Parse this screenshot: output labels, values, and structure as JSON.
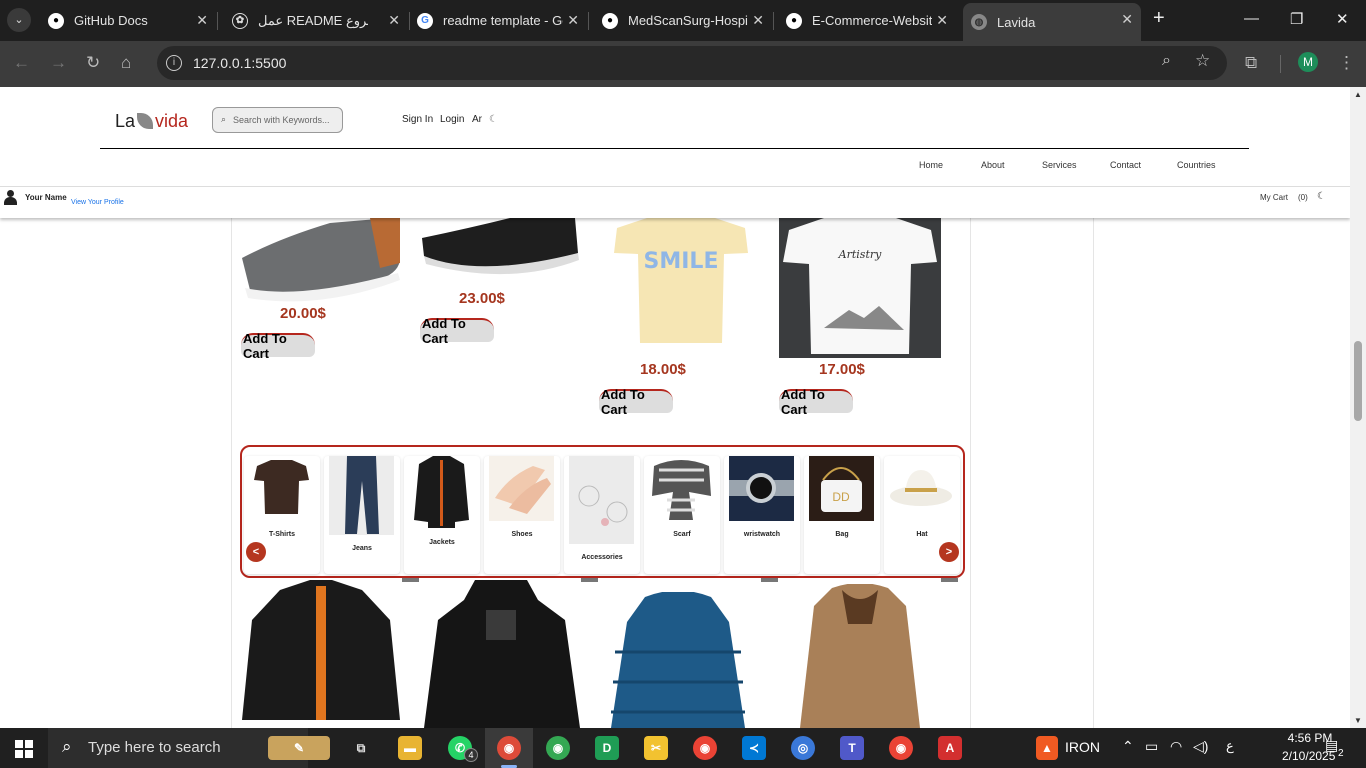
{
  "browser": {
    "tabs": [
      {
        "title": "GitHub Docs"
      },
      {
        "title": "عمل README لمشروع"
      },
      {
        "title": "readme template - Go"
      },
      {
        "title": "MedScanSurg-Hospit"
      },
      {
        "title": "E-Commerce-Website"
      },
      {
        "title": "Lavida"
      }
    ],
    "new_tab": "+",
    "url": "127.0.0.1:5500",
    "profile_initial": "M"
  },
  "site": {
    "logo": {
      "part1": "La",
      "part2": "vida"
    },
    "search_placeholder": "Search with Keywords...",
    "header_links": {
      "sign_in": "Sign In",
      "login": "Login",
      "lang": "Ar",
      "theme": "☾"
    },
    "nav": [
      "Home",
      "About",
      "Services",
      "Contact",
      "Countries"
    ],
    "user": {
      "name": "Your Name",
      "view_profile": "View Your Profile"
    },
    "cart": {
      "label": "My Cart",
      "count": "(0)",
      "theme": "☾"
    }
  },
  "products_top": [
    {
      "name": "grey-sneaker",
      "price": "20.00$",
      "button": "Add To Cart"
    },
    {
      "name": "black-shoe",
      "price": "23.00$",
      "button": "Add To Cart"
    },
    {
      "name": "smile-tshirt",
      "price": "18.00$",
      "button": "Add To Cart"
    },
    {
      "name": "white-tshirt",
      "price": "17.00$",
      "button": "Add To Cart"
    }
  ],
  "categories": [
    {
      "label": "T-Shirts"
    },
    {
      "label": "Jeans"
    },
    {
      "label": "Jackets"
    },
    {
      "label": "Shoes"
    },
    {
      "label": "Accessories"
    },
    {
      "label": "Scarf"
    },
    {
      "label": "wristwatch"
    },
    {
      "label": "Bag"
    },
    {
      "label": "Hat"
    }
  ],
  "carousel": {
    "prev": "<",
    "next": ">"
  },
  "taskbar": {
    "search_text": "Type here to search",
    "whatsapp_badge": "4",
    "iron_label": "IRON",
    "lang": "ع",
    "time": "4:56 PM",
    "date": "2/10/2025",
    "notif_count": "2"
  },
  "colors": {
    "accent": "#b5261d",
    "price": "#a5361f"
  }
}
